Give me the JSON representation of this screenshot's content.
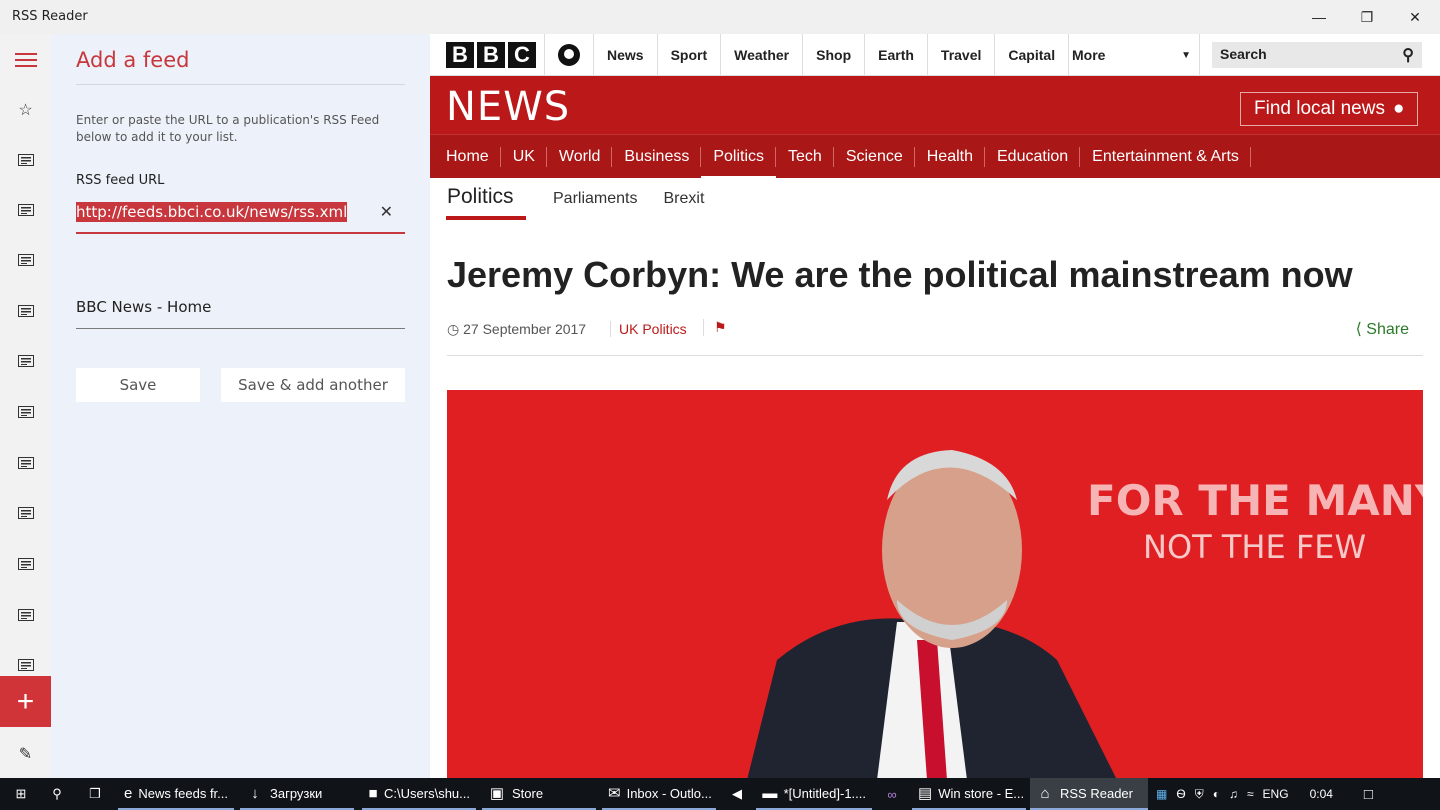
{
  "window": {
    "title": "RSS Reader",
    "minimize_icon": "minimize-icon",
    "maximize_icon": "restore-icon",
    "close_icon": "close-icon"
  },
  "rail": {
    "menu_icon": "hamburger-icon",
    "favorites_icon": "star-icon",
    "feed_icons_count_label": "feed-icon",
    "add_label": "+",
    "edit_icon": "pencil-icon"
  },
  "add_feed": {
    "title": "Add a feed",
    "description": "Enter or paste the URL to a publication's RSS Feed below to add it to your list.",
    "url_label": "RSS feed URL",
    "url_value": "http://feeds.bbci.co.uk/news/rss.xml",
    "feed_name": "BBC News - Home",
    "save_label": "Save",
    "save_add_label": "Save & add another"
  },
  "bbc": {
    "logo": [
      "B",
      "B",
      "C"
    ],
    "top_nav": [
      "News",
      "Sport",
      "Weather",
      "Shop",
      "Earth",
      "Travel",
      "Capital"
    ],
    "more_label": "More",
    "search_placeholder": "Search",
    "news_logo": "NEWS",
    "find_local": "Find local news",
    "section_nav": [
      "Home",
      "UK",
      "World",
      "Business",
      "Politics",
      "Tech",
      "Science",
      "Health",
      "Education",
      "Entertainment & Arts"
    ],
    "active_section": "Politics",
    "sub_nav_active": "Politics",
    "sub_nav": [
      "Parliaments",
      "Brexit"
    ],
    "headline": "Jeremy Corbyn: We are the political mainstream now",
    "date": "27 September 2017",
    "topic": "UK Politics",
    "share": "Share",
    "hero_slogan_1": "FOR THE MANY",
    "hero_slogan_2": "NOT THE FEW"
  },
  "taskbar": {
    "items": [
      {
        "label": "News feeds fr...",
        "icon": "edge-icon"
      },
      {
        "label": "Загрузки",
        "icon": "download-icon"
      },
      {
        "label": "C:\\Users\\shu...",
        "icon": "folder-icon"
      },
      {
        "label": "Store",
        "icon": "store-icon"
      },
      {
        "label": "Inbox - Outlo...",
        "icon": "mail-icon"
      },
      {
        "label": "*[Untitled]-1....",
        "icon": "editor-icon"
      },
      {
        "label": "Win store - E...",
        "icon": "calendar-icon"
      },
      {
        "label": "RSS Reader",
        "icon": "rss-icon"
      }
    ],
    "language": "ENG",
    "time": "0:04"
  }
}
